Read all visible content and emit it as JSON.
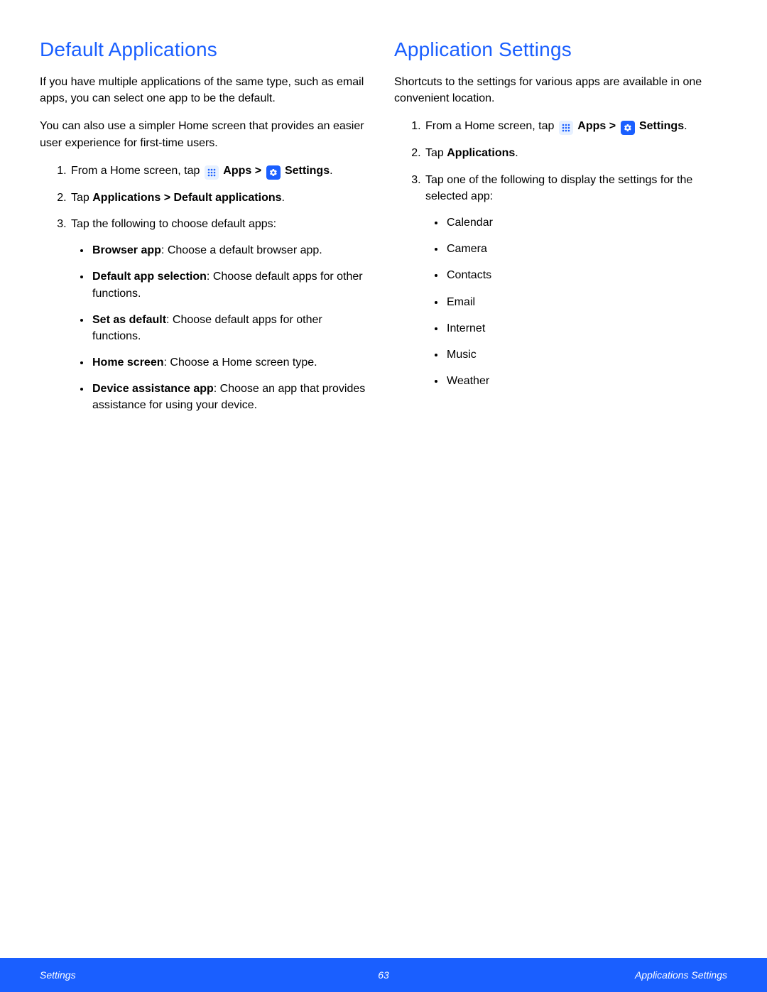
{
  "left": {
    "heading": "Default Applications",
    "para1": "If you have multiple applications of the same type, such as email apps, you can select one app to be the default.",
    "para2": "You can also use a simpler Home screen that provides an easier user experience for first-time users.",
    "step1_prefix": "From a Home screen, tap ",
    "apps_label": "Apps",
    "gt": " > ",
    "settings_label": "Settings",
    "period": ".",
    "step2_prefix": "Tap ",
    "step2_bold": "Applications > Default applications",
    "step3": "Tap the following to choose default apps:",
    "b1_bold": "Browser app",
    "b1_rest": ": Choose a default browser app.",
    "b2_bold": "Default app selection",
    "b2_rest": ": Choose default apps for other functions.",
    "b3_bold": "Set as default",
    "b3_rest": ": Choose default apps for other functions.",
    "b4_bold": "Home screen",
    "b4_rest": ": Choose a Home screen type.",
    "b5_bold": "Device assistance app",
    "b5_rest": ": Choose an app that provides assistance for using your device."
  },
  "right": {
    "heading": "Application Settings",
    "para1": "Shortcuts to the settings for various apps are available in one convenient location.",
    "step1_prefix": "From a Home screen, tap ",
    "apps_label": "Apps",
    "gt": " > ",
    "settings_label": "Settings",
    "period": ".",
    "step2_prefix": "Tap ",
    "step2_bold": "Applications",
    "step3": "Tap one of the following to display the settings for the selected app:",
    "apps": [
      "Calendar",
      "Camera",
      "Contacts",
      "Email",
      "Internet",
      "Music",
      "Weather"
    ]
  },
  "footer": {
    "left": "Settings",
    "center": "63",
    "right": "Applications Settings"
  }
}
